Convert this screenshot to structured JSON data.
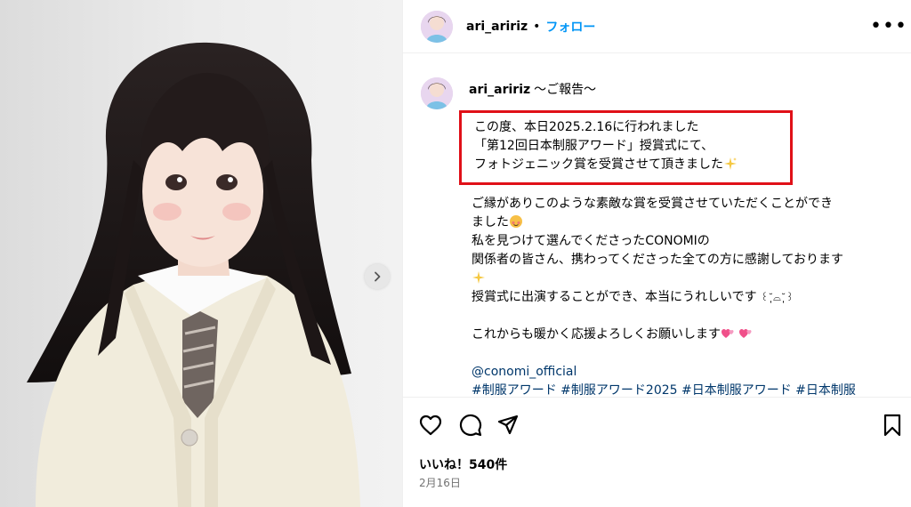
{
  "header": {
    "username": "ari_aririz",
    "separator": "•",
    "follow_label": "フォロー",
    "more_label": "•••"
  },
  "caption": {
    "username": "ari_aririz",
    "title": "〜ご報告〜",
    "highlight_lines": [
      "この度、本日2025.2.16に行われました",
      "「第12回日本制服アワード」授賞式にて、",
      "フォトジェニック賞を受賞させて頂きました"
    ],
    "para1_line1": "ご縁がありこのような素敵な賞を受賞させていただくことができ",
    "para1_line2": "ました",
    "para2_line1": "私を見つけて選んでくださったCONOMIの",
    "para2_line2": "関係者の皆さん、携わってくださった全ての方に感謝しております",
    "para3": "授賞式に出演することができ、本当にうれしいです",
    "para3_emoticon": "꒰˘̩̩̩⌓˘̩̩̩꒱",
    "para4": "これからも暖かく応援よろしくお願いします",
    "mention": "@conomi_official",
    "hashtags": "#制服アワード #制服アワード2025 #日本制服アワード #日本制服"
  },
  "footer": {
    "likes": "いいね！540件",
    "date": "2月16日"
  },
  "icons": {
    "like": "heart-icon",
    "comment": "comment-icon",
    "share": "send-icon",
    "save": "bookmark-icon",
    "next": "chevron-right-icon"
  },
  "colors": {
    "link": "#0095f6",
    "hashtag": "#00376b",
    "highlight_border": "#e01018"
  }
}
